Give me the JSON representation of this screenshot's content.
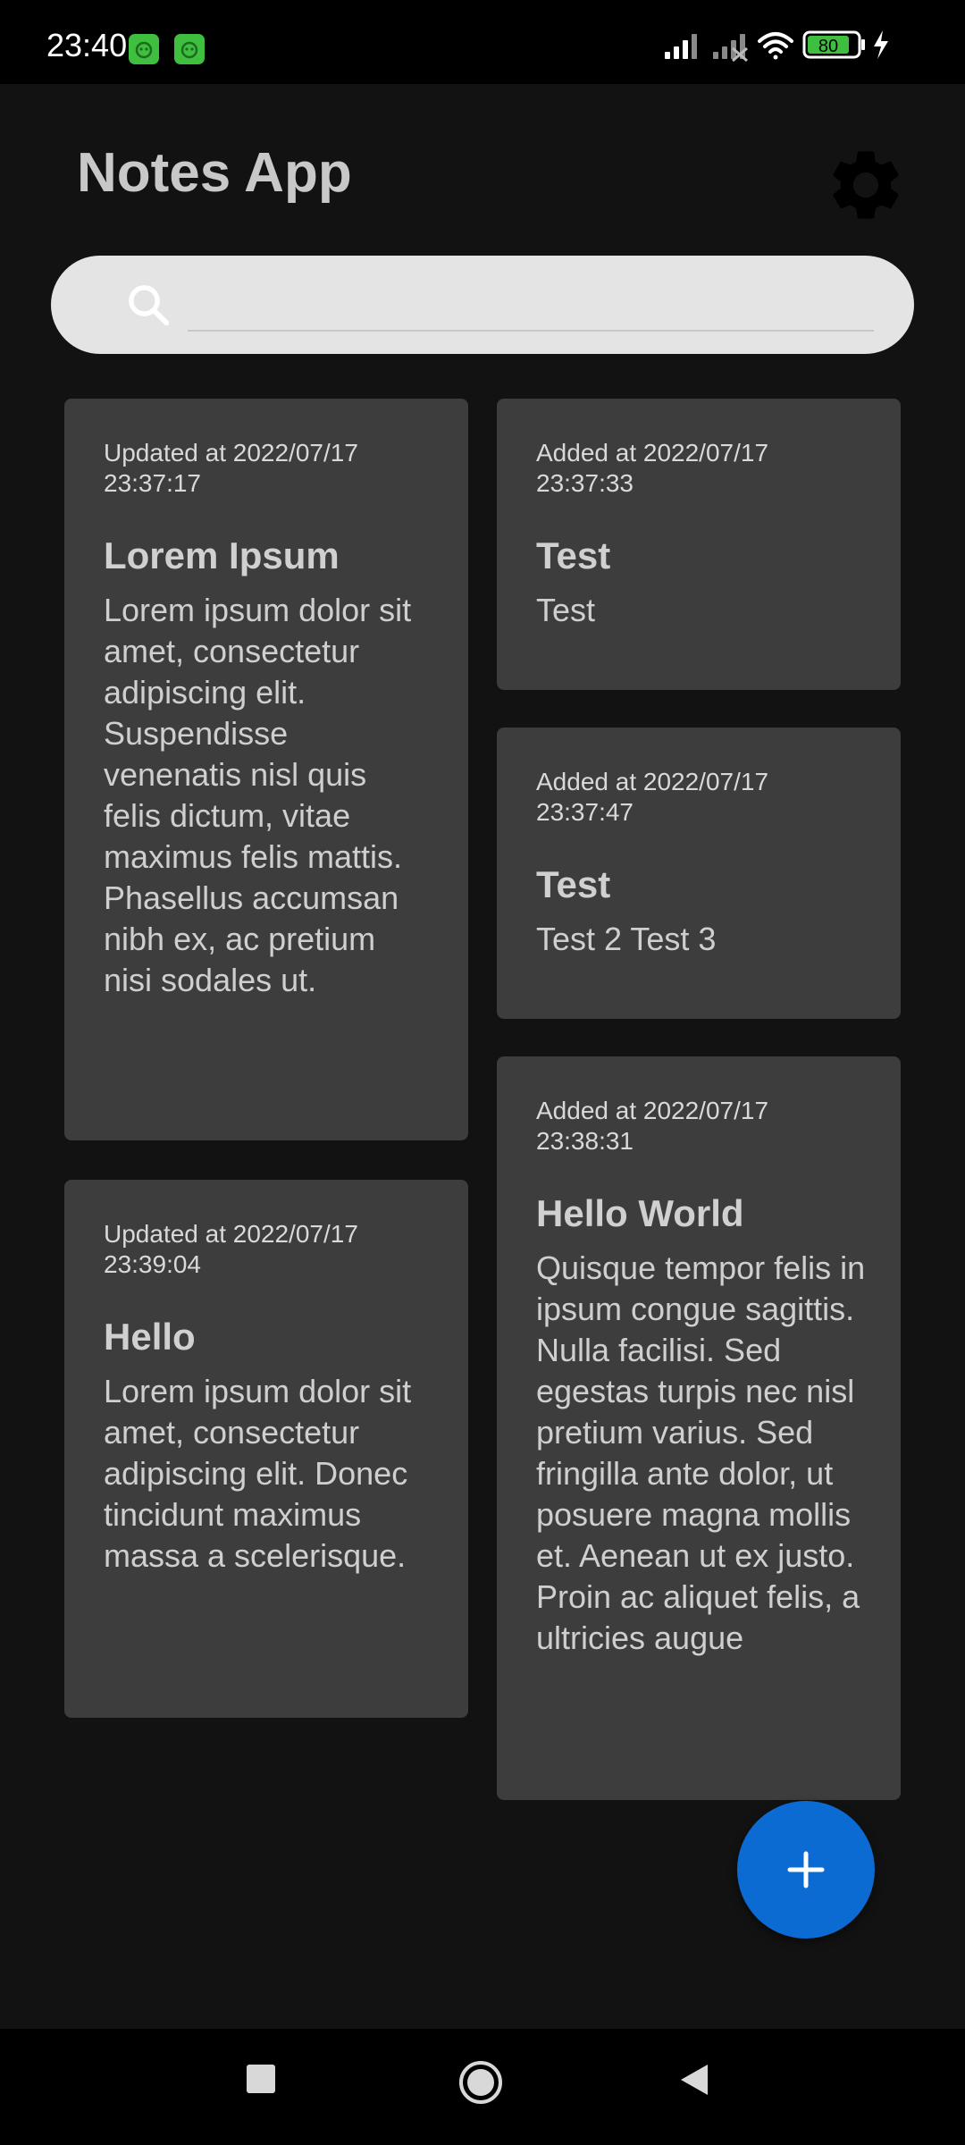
{
  "status_bar": {
    "time": "23:40",
    "battery": "80",
    "icons": [
      "signal-icon",
      "signal-off-icon",
      "wifi-icon",
      "battery-icon",
      "charging-icon"
    ]
  },
  "app": {
    "title": "Notes App",
    "search": {
      "value": "",
      "placeholder": ""
    }
  },
  "notes": [
    {
      "timestamp": "Updated at 2022/07/17 23:37:17",
      "title": "Lorem Ipsum",
      "body": "Lorem ipsum dolor sit amet, consectetur adipiscing elit. Suspendisse venenatis nisl quis felis dictum, vitae maximus felis mattis. Phasellus accumsan nibh ex, ac pretium nisi sodales ut."
    },
    {
      "timestamp": "Added at 2022/07/17 23:37:33",
      "title": "Test",
      "body": "Test"
    },
    {
      "timestamp": "Added at 2022/07/17 23:37:47",
      "title": "Test",
      "body": "Test 2 Test 3"
    },
    {
      "timestamp": "Updated at 2022/07/17 23:39:04",
      "title": "Hello",
      "body": "Lorem ipsum dolor sit amet, consectetur adipiscing elit. Donec tincidunt maximus massa a scelerisque."
    },
    {
      "timestamp": "Added at 2022/07/17 23:38:31",
      "title": "Hello World",
      "body": "Quisque tempor felis in ipsum congue sagittis. Nulla facilisi. Sed egestas turpis nec nisl pretium varius. Sed fringilla ante dolor, ut posuere magna mollis et. Aenean ut ex justo. Proin ac aliquet felis, a ultricies augue"
    }
  ],
  "colors": {
    "background": "#121212",
    "card": "#3d3d3d",
    "search_bar": "#e4e4e4",
    "fab": "#0b6bd3"
  }
}
